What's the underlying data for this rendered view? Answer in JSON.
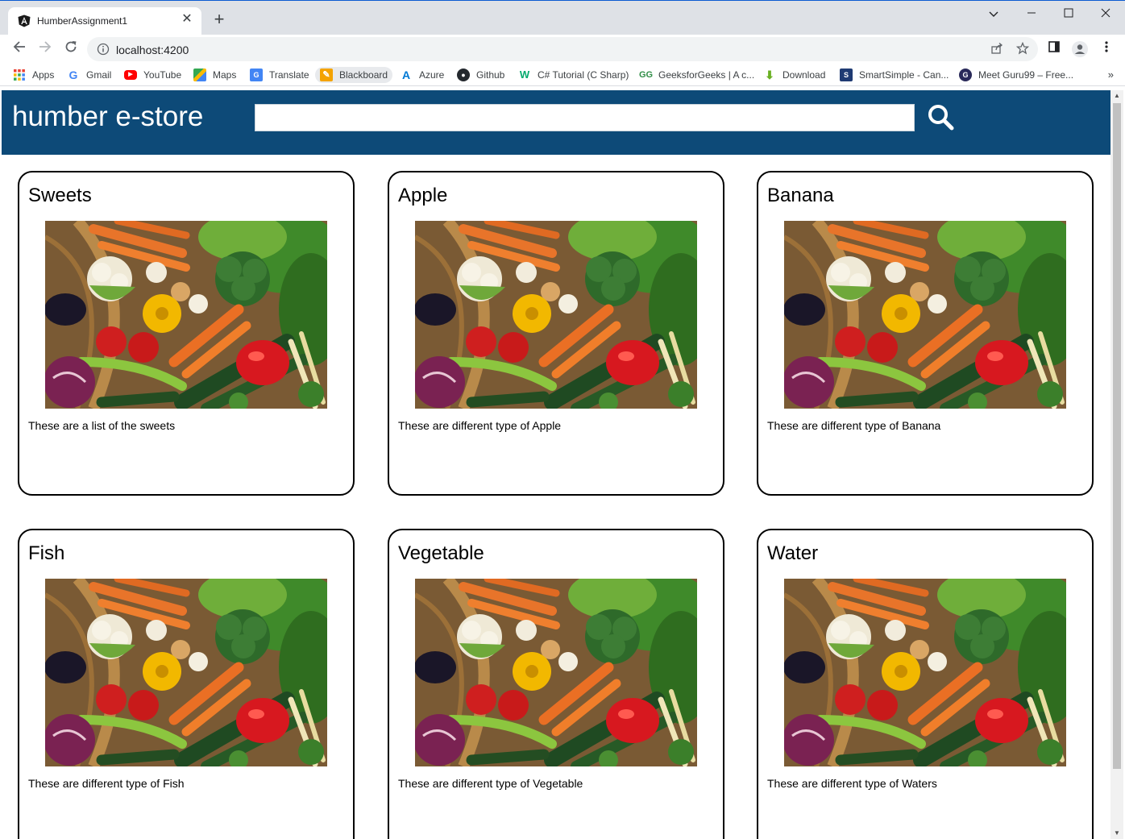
{
  "browser": {
    "tab_title": "HumberAssignment1",
    "url": "localhost:4200",
    "bookmarks": [
      {
        "label": "Apps",
        "icon": "apps-grid-icon",
        "color": "#ea4335"
      },
      {
        "label": "Gmail",
        "icon": "google-icon",
        "color": "#4285f4"
      },
      {
        "label": "YouTube",
        "icon": "youtube-icon",
        "color": "#ff0000"
      },
      {
        "label": "Maps",
        "icon": "maps-icon",
        "color": "#34a853"
      },
      {
        "label": "Translate",
        "icon": "translate-icon",
        "color": "#4285f4"
      },
      {
        "label": "Blackboard",
        "icon": "blackboard-icon",
        "color": "#f4a300"
      },
      {
        "label": "Azure",
        "icon": "azure-icon",
        "color": "#0078d4"
      },
      {
        "label": "Github",
        "icon": "github-icon",
        "color": "#24292e"
      },
      {
        "label": "C# Tutorial (C Sharp)",
        "icon": "w3schools-icon",
        "color": "#04aa6d"
      },
      {
        "label": "GeeksforGeeks | A c...",
        "icon": "geeksforgeeks-icon",
        "color": "#2f8d46"
      },
      {
        "label": "Download",
        "icon": "download-icon",
        "color": "#6ab023"
      },
      {
        "label": "SmartSimple - Can...",
        "icon": "smartsimple-icon",
        "color": "#1f3b73"
      },
      {
        "label": "Meet Guru99 – Free...",
        "icon": "guru99-icon",
        "color": "#2a2a5a"
      }
    ],
    "more_label": "»"
  },
  "header": {
    "title": "humber e-store",
    "search_placeholder": "",
    "accent_color": "#0d4a78"
  },
  "products": [
    {
      "title": "Sweets",
      "description": "These are a list of the sweets"
    },
    {
      "title": "Apple",
      "description": "These are different type of Apple"
    },
    {
      "title": "Banana",
      "description": "These are different type of Banana"
    },
    {
      "title": "Fish",
      "description": "These are different type of Fish"
    },
    {
      "title": "Vegetable",
      "description": "These are different type of Vegetable"
    },
    {
      "title": "Water",
      "description": "These are different type of Waters"
    }
  ]
}
